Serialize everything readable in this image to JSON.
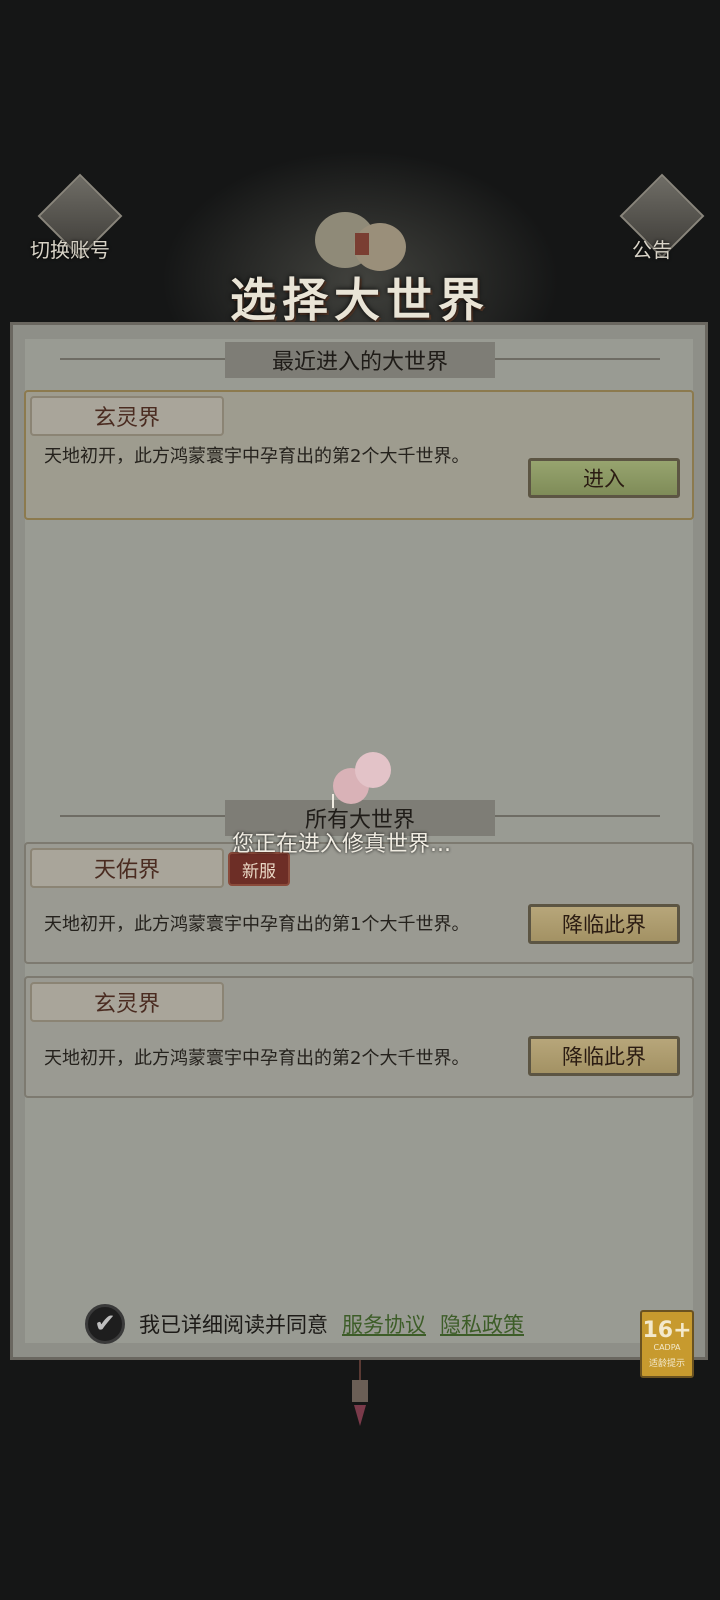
{
  "top": {
    "switch_account_label": "切换账号",
    "notice_label": "公告",
    "title": "选择大世界"
  },
  "recent_section": {
    "title": "最近进入的大世界",
    "worlds": [
      {
        "name": "玄灵界",
        "description": "天地初开，此方鸿蒙寰宇中孕育出的第2个大千世界。",
        "button_label": "进入"
      }
    ]
  },
  "all_section": {
    "title": "所有大世界",
    "worlds": [
      {
        "name": "天佑界",
        "badge": "新服",
        "description": "天地初开，此方鸿蒙寰宇中孕育出的第1个大千世界。",
        "button_label": "降临此界"
      },
      {
        "name": "玄灵界",
        "description": "天地初开，此方鸿蒙寰宇中孕育出的第2个大千世界。",
        "button_label": "降临此界"
      }
    ]
  },
  "agreement": {
    "checked": true,
    "text": "我已详细阅读并同意",
    "service_link": "服务协议",
    "privacy_link": "隐私政策"
  },
  "age_rating": {
    "rating": "16+",
    "org": "CADPA",
    "label": "适龄提示"
  },
  "loading": {
    "text": "您正在进入修真世界..."
  },
  "colors": {
    "button_green": "#8a9763",
    "button_gold": "#ad9c6e",
    "link_green": "#3d5d28",
    "badge_red": "#6d2e26"
  }
}
